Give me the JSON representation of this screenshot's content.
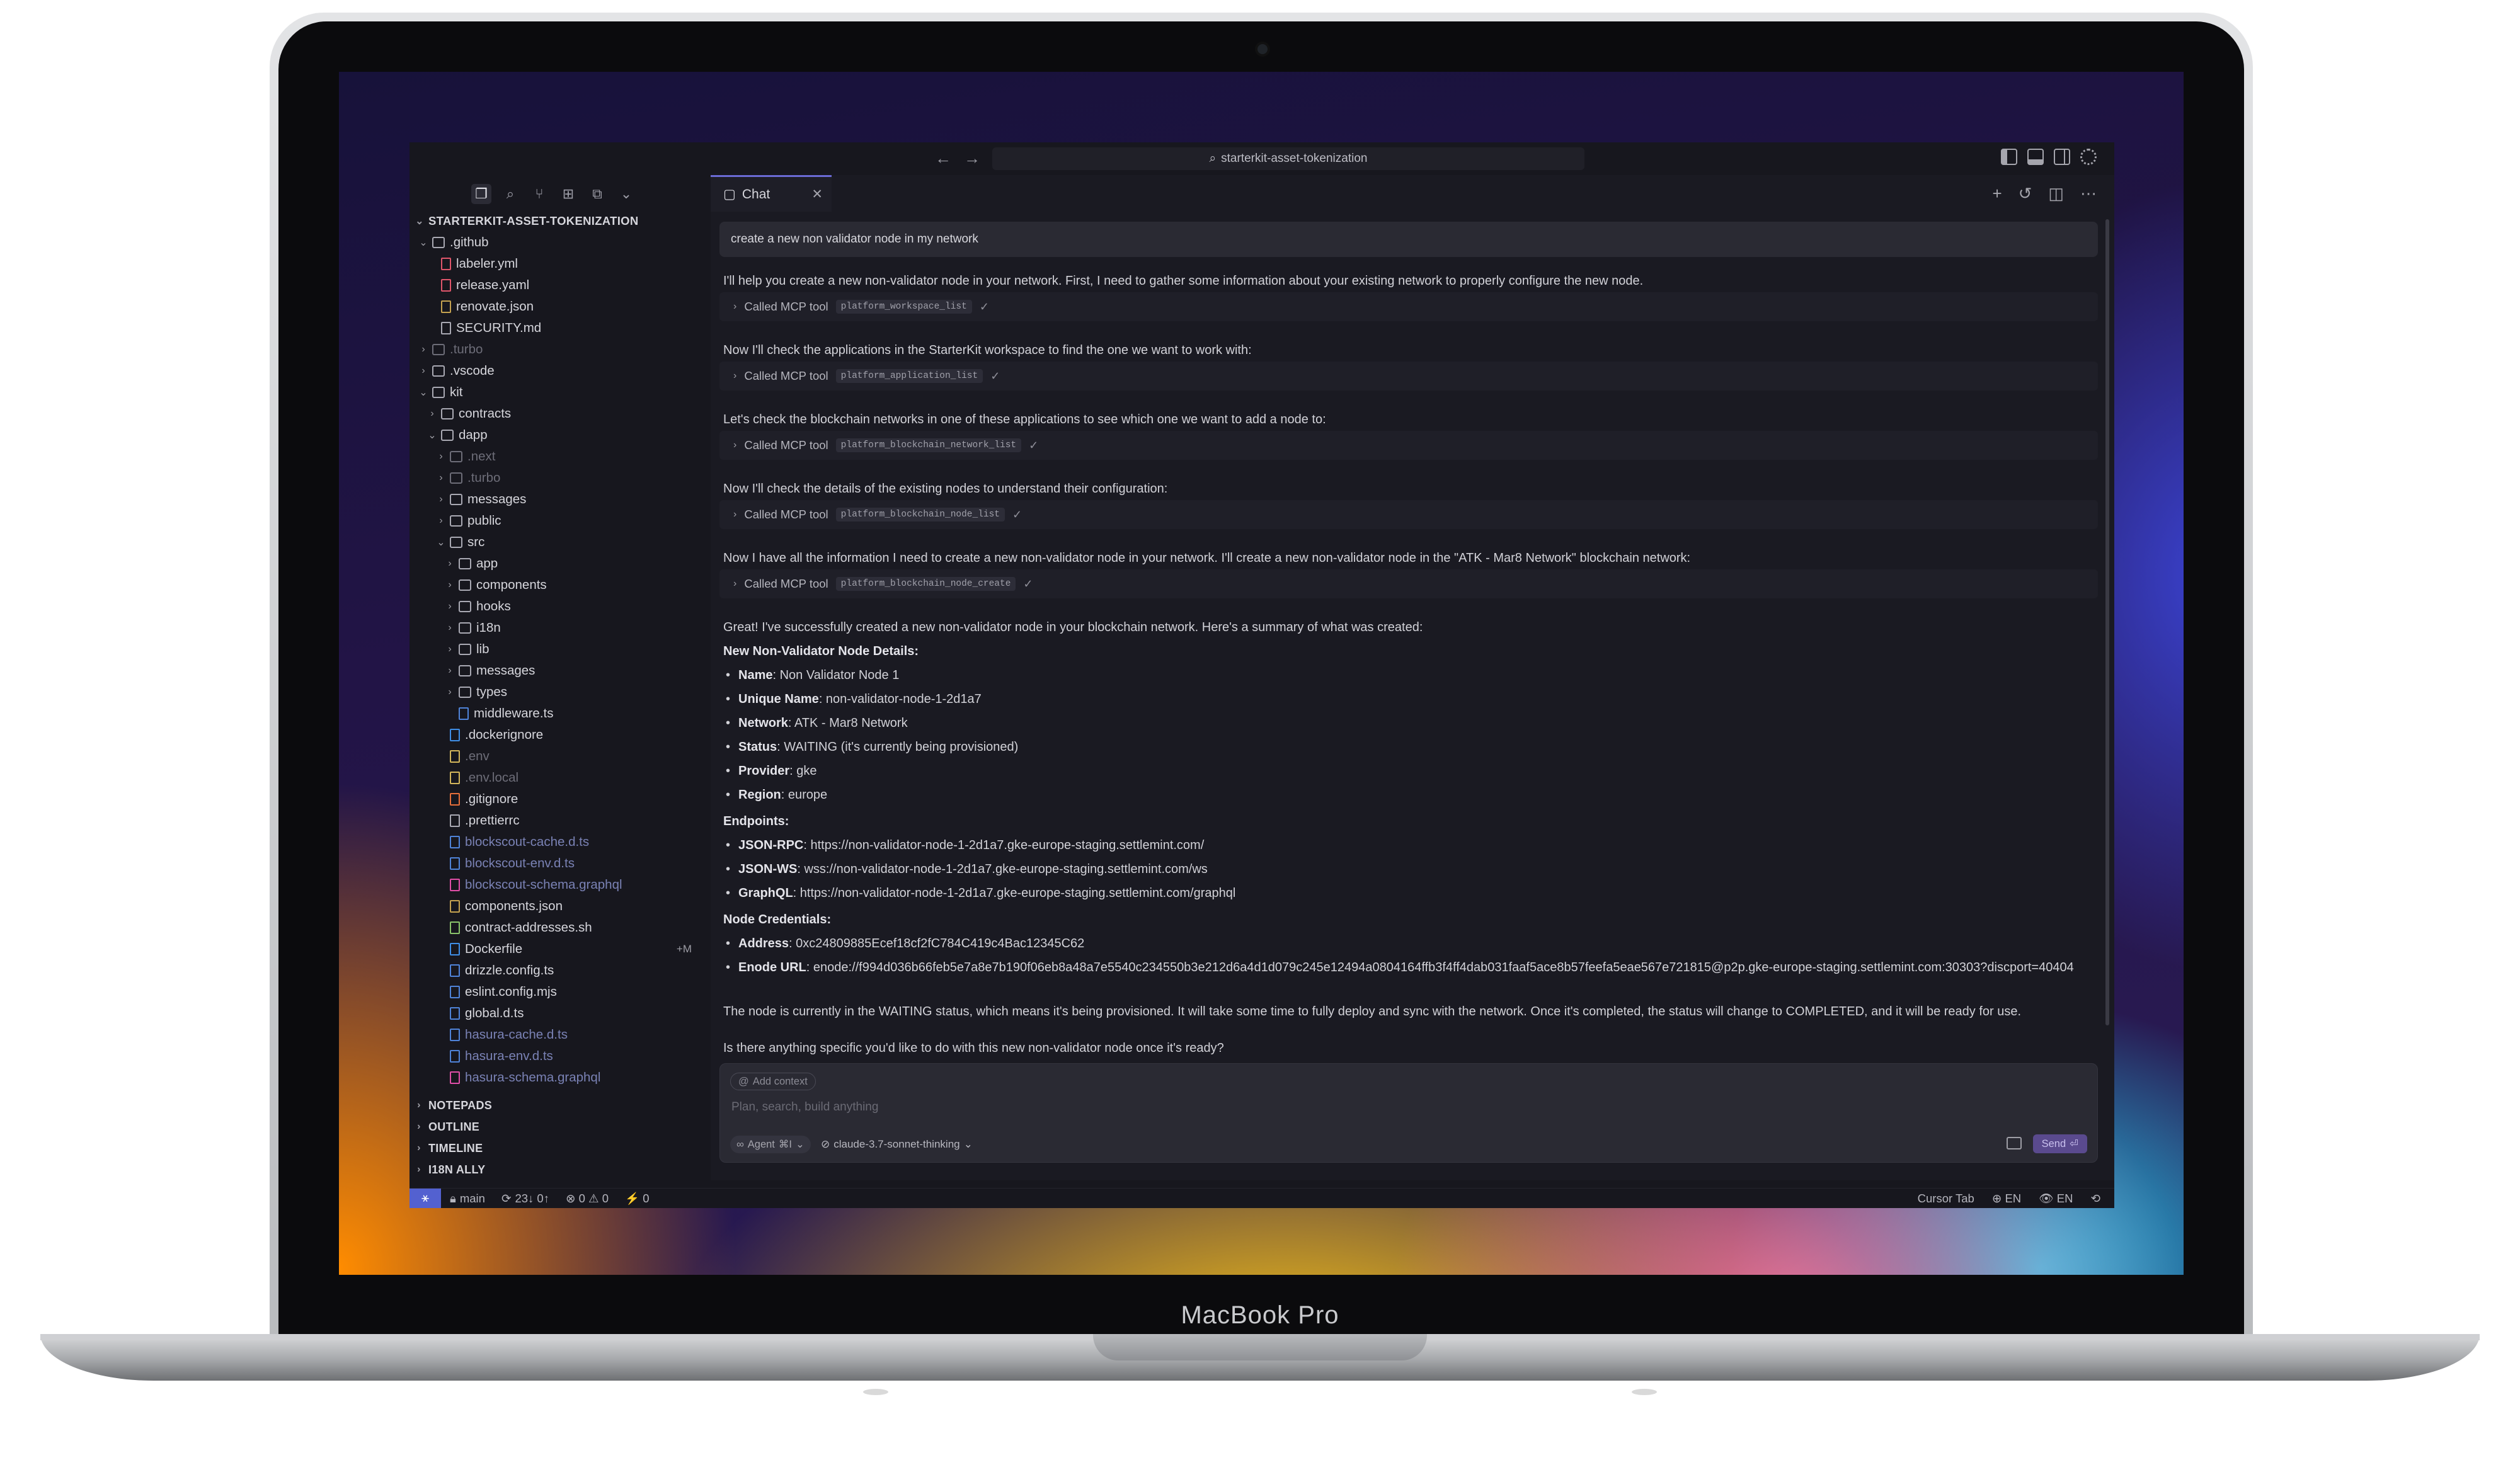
{
  "device": {
    "label": "MacBook Pro"
  },
  "titlebar": {
    "search": "starterkit-asset-tokenization",
    "back_icon": "←",
    "forward_icon": "→"
  },
  "sidebar": {
    "root": "STARTERKIT-ASSET-TOKENIZATION",
    "tree": [
      {
        "name": ".github",
        "depth": 0,
        "type": "folder",
        "open": true
      },
      {
        "name": "labeler.yml",
        "depth": 1,
        "type": "yaml"
      },
      {
        "name": "release.yaml",
        "depth": 1,
        "type": "yaml"
      },
      {
        "name": "renovate.json",
        "depth": 1,
        "type": "json"
      },
      {
        "name": "SECURITY.md",
        "depth": 1,
        "type": "md"
      },
      {
        "name": ".turbo",
        "depth": 0,
        "type": "folder",
        "dim": true
      },
      {
        "name": ".vscode",
        "depth": 0,
        "type": "folder"
      },
      {
        "name": "kit",
        "depth": 0,
        "type": "folder",
        "open": true
      },
      {
        "name": "contracts",
        "depth": 1,
        "type": "folder"
      },
      {
        "name": "dapp",
        "depth": 1,
        "type": "folder",
        "open": true
      },
      {
        "name": ".next",
        "depth": 2,
        "type": "folder",
        "dim": true
      },
      {
        "name": ".turbo",
        "depth": 2,
        "type": "folder",
        "dim": true
      },
      {
        "name": "messages",
        "depth": 2,
        "type": "folder"
      },
      {
        "name": "public",
        "depth": 2,
        "type": "folder"
      },
      {
        "name": "src",
        "depth": 2,
        "type": "folder",
        "open": true
      },
      {
        "name": "app",
        "depth": 3,
        "type": "folder"
      },
      {
        "name": "components",
        "depth": 3,
        "type": "folder"
      },
      {
        "name": "hooks",
        "depth": 3,
        "type": "folder"
      },
      {
        "name": "i18n",
        "depth": 3,
        "type": "folder"
      },
      {
        "name": "lib",
        "depth": 3,
        "type": "folder"
      },
      {
        "name": "messages",
        "depth": 3,
        "type": "folder"
      },
      {
        "name": "types",
        "depth": 3,
        "type": "folder"
      },
      {
        "name": "middleware.ts",
        "depth": 3,
        "type": "ts",
        "file": true
      },
      {
        "name": ".dockerignore",
        "depth": 2,
        "type": "dock",
        "file": true
      },
      {
        "name": ".env",
        "depth": 2,
        "type": "env",
        "file": true,
        "dim": true
      },
      {
        "name": ".env.local",
        "depth": 2,
        "type": "env",
        "file": true,
        "dim": true
      },
      {
        "name": ".gitignore",
        "depth": 2,
        "type": "git",
        "file": true
      },
      {
        "name": ".prettierrc",
        "depth": 2,
        "type": "md",
        "file": true
      },
      {
        "name": "blockscout-cache.d.ts",
        "depth": 2,
        "type": "ts",
        "file": true,
        "teal": true
      },
      {
        "name": "blockscout-env.d.ts",
        "depth": 2,
        "type": "ts",
        "file": true,
        "teal": true
      },
      {
        "name": "blockscout-schema.graphql",
        "depth": 2,
        "type": "gql",
        "file": true,
        "teal": true
      },
      {
        "name": "components.json",
        "depth": 2,
        "type": "json",
        "file": true
      },
      {
        "name": "contract-addresses.sh",
        "depth": 2,
        "type": "sh",
        "file": true
      },
      {
        "name": "Dockerfile",
        "depth": 2,
        "type": "dock",
        "file": true,
        "badge": "+M"
      },
      {
        "name": "drizzle.config.ts",
        "depth": 2,
        "type": "ts",
        "file": true
      },
      {
        "name": "eslint.config.mjs",
        "depth": 2,
        "type": "ts",
        "file": true
      },
      {
        "name": "global.d.ts",
        "depth": 2,
        "type": "ts",
        "file": true
      },
      {
        "name": "hasura-cache.d.ts",
        "depth": 2,
        "type": "ts",
        "file": true,
        "teal": true
      },
      {
        "name": "hasura-env.d.ts",
        "depth": 2,
        "type": "ts",
        "file": true,
        "teal": true
      },
      {
        "name": "hasura-schema.graphql",
        "depth": 2,
        "type": "gql",
        "file": true,
        "teal": true
      }
    ],
    "sections": [
      "NOTEPADS",
      "OUTLINE",
      "TIMELINE",
      "I18N ALLY"
    ]
  },
  "chat": {
    "tab_label": "Chat",
    "user_query": "create a new non validator node in my network",
    "messages": [
      "I'll help you create a new non-validator node in your network. First, I need to gather some information about your existing network to properly configure the new node.",
      "Now I'll check the applications in the StarterKit workspace to find the one we want to work with:",
      "Let's check the blockchain networks in one of these applications to see which one we want to add a node to:",
      "Now I'll check the details of the existing nodes to understand their configuration:",
      "Now I have all the information I need to create a new non-validator node in your network. I'll create a new non-validator node in the \"ATK - Mar8 Network\" blockchain network:"
    ],
    "tool_label": "Called MCP tool",
    "tools": [
      "platform_workspace_list",
      "platform_application_list",
      "platform_blockchain_network_list",
      "platform_blockchain_node_list",
      "platform_blockchain_node_create"
    ],
    "summary_intro": "Great! I've successfully created a new non-validator node in your blockchain network. Here's a summary of what was created:",
    "details_heading": "New Non-Validator Node Details:",
    "details": [
      {
        "k": "Name",
        "v": ": Non Validator Node 1"
      },
      {
        "k": "Unique Name",
        "v": ": non-validator-node-1-2d1a7"
      },
      {
        "k": "Network",
        "v": ": ATK - Mar8 Network"
      },
      {
        "k": "Status",
        "v": ": WAITING (it's currently being provisioned)"
      },
      {
        "k": "Provider",
        "v": ": gke"
      },
      {
        "k": "Region",
        "v": ": europe"
      }
    ],
    "endpoints_heading": "Endpoints:",
    "endpoints": [
      {
        "k": "JSON-RPC",
        "v": ": https://non-validator-node-1-2d1a7.gke-europe-staging.settlemint.com/"
      },
      {
        "k": "JSON-WS",
        "v": ": wss://non-validator-node-1-2d1a7.gke-europe-staging.settlemint.com/ws"
      },
      {
        "k": "GraphQL",
        "v": ": https://non-validator-node-1-2d1a7.gke-europe-staging.settlemint.com/graphql"
      }
    ],
    "creds_heading": "Node Credentials:",
    "creds": [
      {
        "k": "Address",
        "v": ": 0xc24809885Ecef18cf2fC784C419c4Bac12345C62"
      },
      {
        "k": "Enode URL",
        "v": ": enode://f994d036b66feb5e7a8e7b190f06eb8a48a7e5540c234550b3e212d6a4d1d079c245e12494a0804164ffb3f4ff4dab031faaf5ace8b57feefa5eae567e721815@p2p.gke-europe-staging.settlemint.com:30303?discport=40404"
      }
    ],
    "closing": "The node is currently in the WAITING status, which means it's being provisioned. It will take some time to fully deploy and sync with the network. Once it's completed, the status will change to COMPLETED, and it will be ready for use.",
    "question": "Is there anything specific you'd like to do with this new non-validator node once it's ready?",
    "composer": {
      "add_context": "Add context",
      "placeholder": "Plan, search, build anything",
      "mode": "Agent",
      "mode_shortcut": "⌘I",
      "model": "claude-3.7-sonnet-thinking",
      "send": "Send",
      "send_shortcut": "⏎"
    }
  },
  "statusbar": {
    "branch": "main",
    "sync": "23↓ 0↑",
    "problems": "⊗ 0 ⚠ 0",
    "ports": "⚡ 0",
    "cursor_tab": "Cursor Tab",
    "lang1": "⊕ EN",
    "lang2": "👁 EN"
  }
}
